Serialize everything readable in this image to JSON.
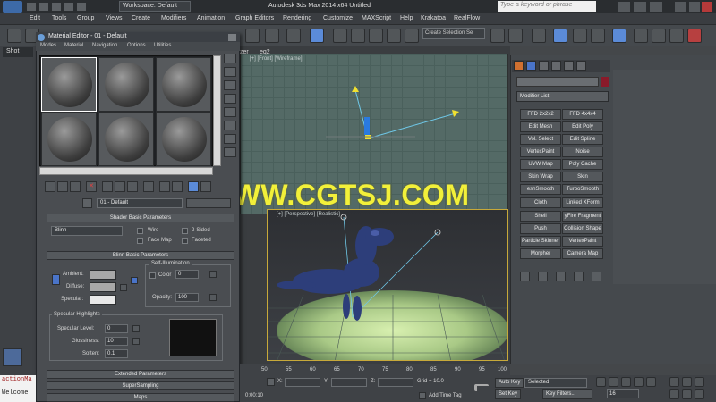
{
  "app": {
    "title": "Autodesk 3ds Max 2014 x64      Untitled",
    "workspace": "Workspace: Default",
    "search_placeholder": "Type a keyword or phrase"
  },
  "menu": [
    "Edit",
    "Tools",
    "Group",
    "Views",
    "Create",
    "Modifiers",
    "Animation",
    "Graph Editors",
    "Rendering",
    "Customize",
    "MAXScript",
    "Help",
    "Krakatoa",
    "RealFlow"
  ],
  "toolbar": {
    "selection_set": "Create Selection Se"
  },
  "left": {
    "shot_label": "Shot"
  },
  "viewports": {
    "front_label": "[+] [Front] [Wireframe]",
    "persp_label": "[+] [Perspective] [Realistic]",
    "tab_eq2": "eq2",
    "tab_zer": "zer"
  },
  "command_panel": {
    "modifier_list": "Modifier List",
    "buttons": [
      [
        "FFD 2x2x2",
        "FFD 4x4x4"
      ],
      [
        "Edit Mesh",
        "Edit Poly"
      ],
      [
        "Vol. Select",
        "Edit Spline"
      ],
      [
        "VertexPaint",
        "Noise"
      ],
      [
        "UVW Map",
        "Poly Cache"
      ],
      [
        "Skin Wrap",
        "Skin"
      ],
      [
        "eshSmooth",
        "TurboSmooth"
      ],
      [
        "Cloth",
        "Linked XForm"
      ],
      [
        "Shell",
        "yFire Fragment"
      ],
      [
        "Push",
        "Collision Shape"
      ],
      [
        "Particle Skinner",
        "VertexPaint"
      ],
      [
        "Morpher",
        "Camera Map"
      ]
    ]
  },
  "material_editor": {
    "title": "Material Editor - 01 - Default",
    "menu": [
      "Modes",
      "Material",
      "Navigation",
      "Options",
      "Utilities"
    ],
    "material_name": "01 - Default",
    "shader_rollout": "Shader Basic Parameters",
    "shader_type": "Blinn",
    "wire": "Wire",
    "two_sided": "2-Sided",
    "face_map": "Face Map",
    "faceted": "Faceted",
    "blinn_rollout": "Blinn Basic Parameters",
    "self_illum": "Self-Illumination",
    "ambient": "Ambient:",
    "diffuse": "Diffuse:",
    "specular": "Specular:",
    "color": "Color",
    "color_value": "0",
    "opacity_label": "Opacity:",
    "opacity_value": "100",
    "spec_highlights": "Specular Highlights",
    "specular_level": "Specular Level:",
    "specular_level_value": "0",
    "glossiness": "Glossiness:",
    "glossiness_value": "10",
    "soften": "Soften:",
    "soften_value": "0.1",
    "extended": "Extended Parameters",
    "supersampling": "SuperSampling",
    "maps": "Maps"
  },
  "timeline": {
    "ticks": [
      "50",
      "55",
      "60",
      "65",
      "70",
      "75",
      "80",
      "85",
      "90",
      "95",
      "100"
    ]
  },
  "status": {
    "x_label": "X:",
    "y_label": "Y:",
    "z_label": "Z:",
    "grid": "Grid = 10.0",
    "auto_key": "Auto Key",
    "selected": "Selected",
    "set_key": "Set Key",
    "key_filters": "Key Filters...",
    "add_time_tag": "Add Time Tag",
    "time": "0:00:10",
    "frame": "16"
  },
  "listener": {
    "line1": "actionMa",
    "line2": "Welcome"
  },
  "watermark": "WWW.CGTSJ.COM",
  "colors": {
    "accent": "#5b8bd8",
    "watermark": "#f2f03a",
    "object_color": "#8a1a2a"
  }
}
